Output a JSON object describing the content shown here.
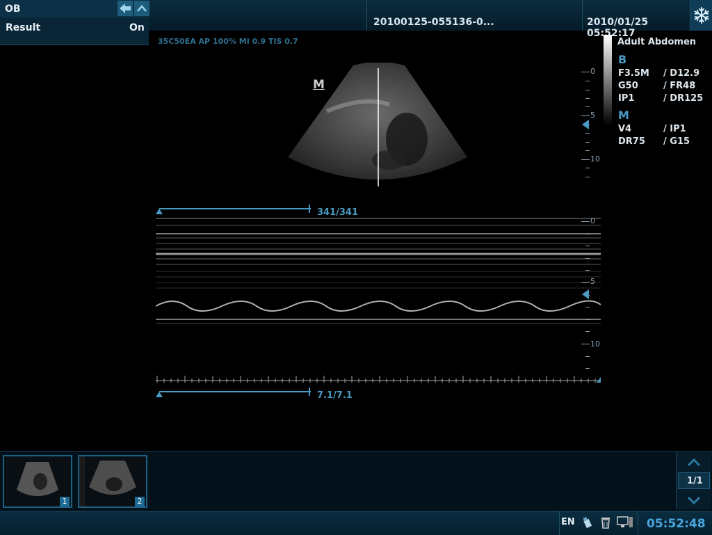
{
  "left_panel": {
    "exam": "OB",
    "result_label": "Result",
    "result_value": "On"
  },
  "header": {
    "file_id": "20100125-055136-0...",
    "datetime": "2010/01/25  05:52:17",
    "freeze_icon": "snowflake-icon"
  },
  "image_info": "35C50EA  AP 100%  MI 0.9  TIS 0.7",
  "params": {
    "preset": "Adult Abdomen",
    "b_mode": "B",
    "b_rows": [
      [
        "F3.5M",
        "/ D12.9"
      ],
      [
        "G50",
        "/ FR48"
      ],
      [
        "IP1",
        "/ DR125"
      ]
    ],
    "m_mode": "M",
    "m_rows": [
      [
        "V4",
        "/ IP1"
      ],
      [
        "DR75",
        "/ G15"
      ]
    ]
  },
  "b_marker": "M",
  "b_depth_labels": [
    "0",
    "5",
    "10"
  ],
  "m_depth_labels": [
    "0",
    "5",
    "10"
  ],
  "cine": {
    "frames": "341/341",
    "time": "7.1/7.1"
  },
  "thumbnails": [
    {
      "num": "1"
    },
    {
      "num": "2"
    }
  ],
  "pager": {
    "page": "1/1"
  },
  "status": {
    "lang": "EN",
    "time": "05:52:48"
  },
  "colors": {
    "accent": "#4a9bc4",
    "panel": "#0a2636",
    "clock": "#4aa6dd"
  }
}
